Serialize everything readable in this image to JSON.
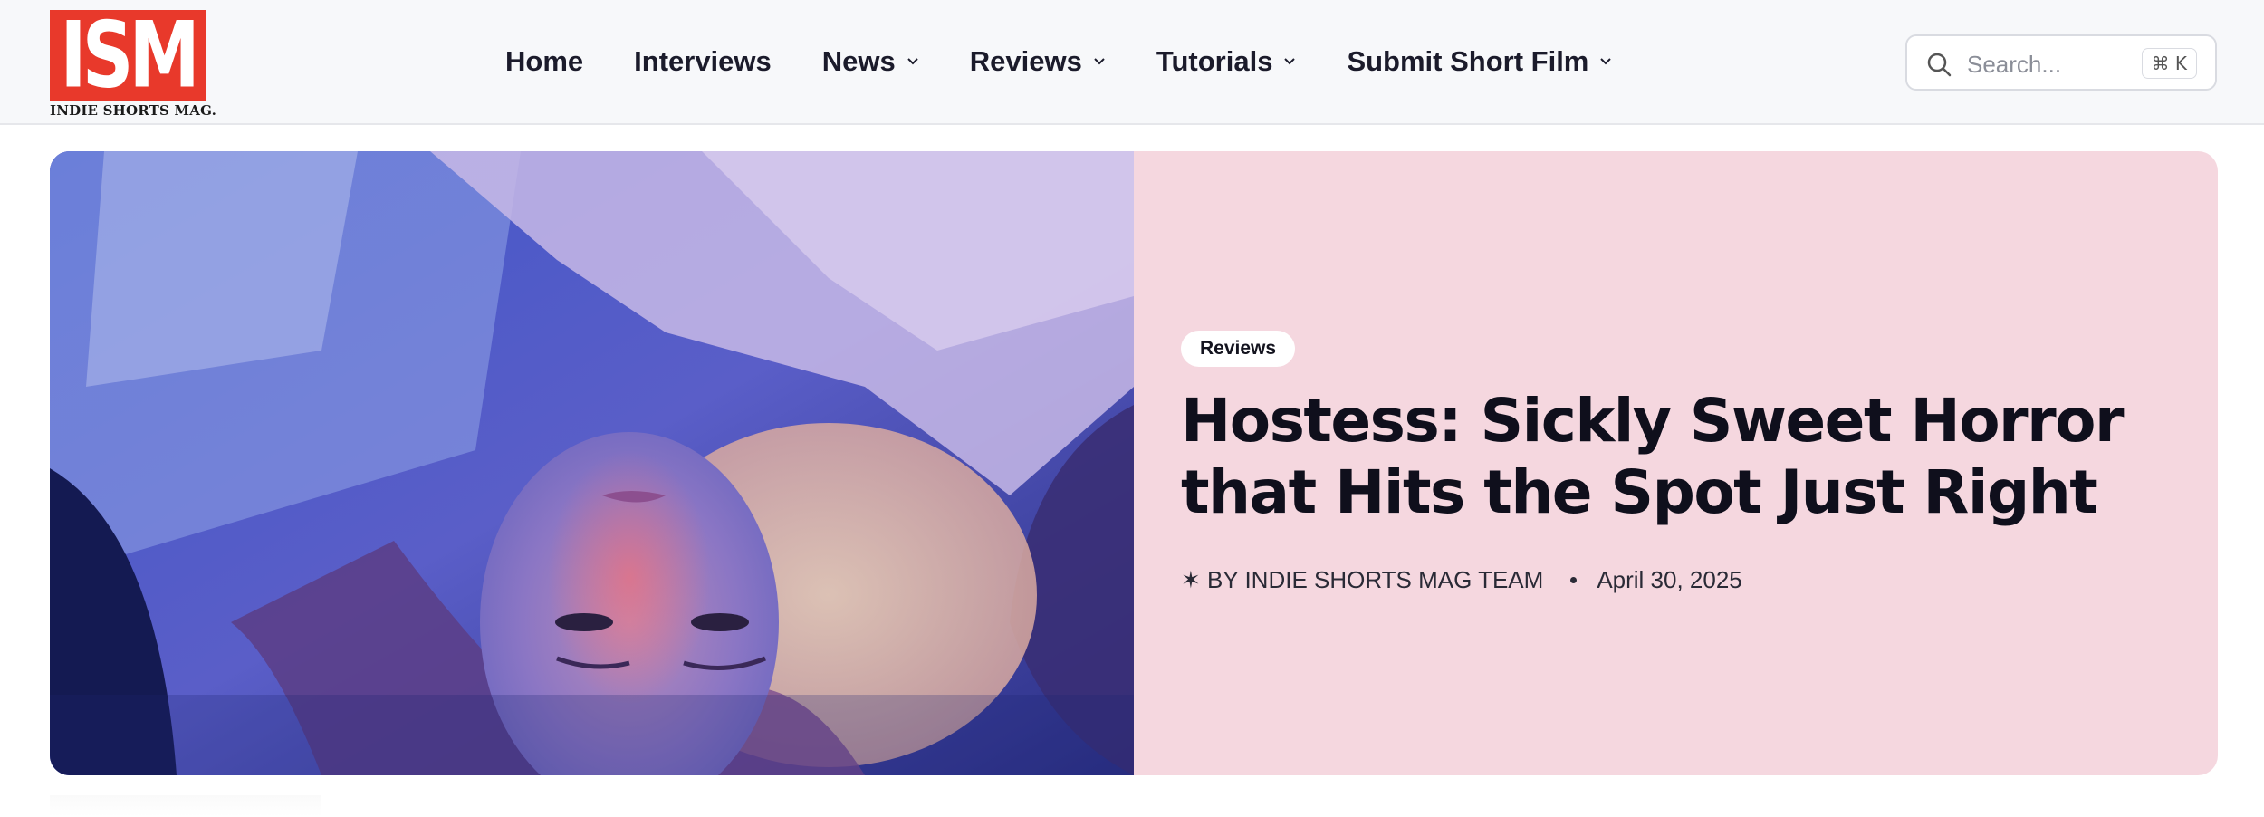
{
  "header": {
    "logo": {
      "mark": "ISM",
      "subtitle": "INDIE SHORTS MAG."
    },
    "nav": [
      {
        "label": "Home",
        "has_dropdown": false
      },
      {
        "label": "Interviews",
        "has_dropdown": false
      },
      {
        "label": "News",
        "has_dropdown": true
      },
      {
        "label": "Reviews",
        "has_dropdown": true
      },
      {
        "label": "Tutorials",
        "has_dropdown": true
      },
      {
        "label": "Submit Short Film",
        "has_dropdown": true
      }
    ],
    "search": {
      "placeholder": "Search...",
      "shortcut": "⌘ K"
    }
  },
  "featured": {
    "category": "Reviews",
    "title": "Hostess: Sickly Sweet Horror that Hits the Spot Just Right",
    "author": "✶ BY INDIE SHORTS MAG TEAM",
    "date": "April 30, 2025",
    "image_alt": "Woman lying upside down on a bed lit in blue and red light"
  },
  "colors": {
    "logo_red": "#e8392b",
    "header_bg": "#f7f8fa",
    "hero_panel_bg": "#f5d7df",
    "text_dark": "#0f0f1c"
  }
}
